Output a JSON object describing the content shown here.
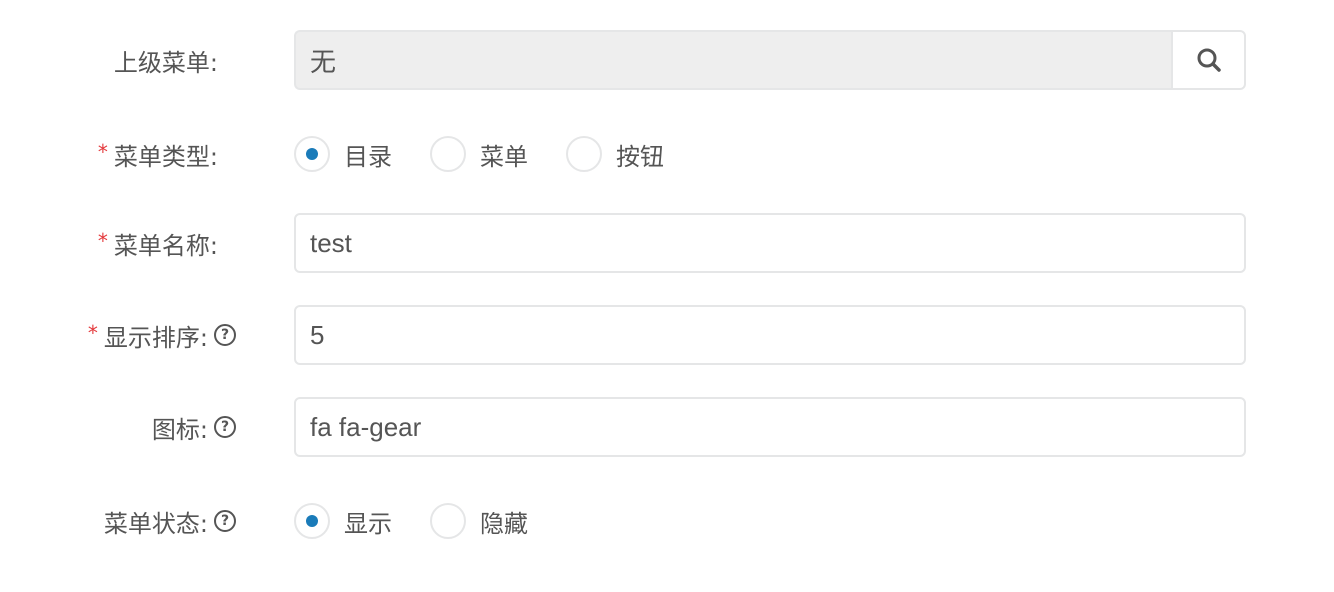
{
  "form": {
    "parent_menu": {
      "label": "上级菜单:",
      "value": "无",
      "search_icon": "search-icon"
    },
    "menu_type": {
      "label": "菜单类型:",
      "required_mark": "*",
      "options": [
        {
          "label": "目录",
          "checked": true
        },
        {
          "label": "菜单",
          "checked": false
        },
        {
          "label": "按钮",
          "checked": false
        }
      ]
    },
    "menu_name": {
      "label": "菜单名称:",
      "required_mark": "*",
      "value": "test"
    },
    "display_order": {
      "label": "显示排序:",
      "required_mark": "*",
      "value": "5",
      "help_icon": "question-circle-icon",
      "help_glyph": "?"
    },
    "icon": {
      "label": "图标:",
      "value": "fa fa-gear",
      "help_icon": "question-circle-icon",
      "help_glyph": "?"
    },
    "menu_status": {
      "label": "菜单状态:",
      "help_icon": "question-circle-icon",
      "help_glyph": "?",
      "options": [
        {
          "label": "显示",
          "checked": true
        },
        {
          "label": "隐藏",
          "checked": false
        }
      ]
    }
  },
  "colors": {
    "accent": "#1a7bb9",
    "required": "#e4393c",
    "text": "#555555",
    "border": "#e5e6e7",
    "readonly_bg": "#eeeeee"
  }
}
